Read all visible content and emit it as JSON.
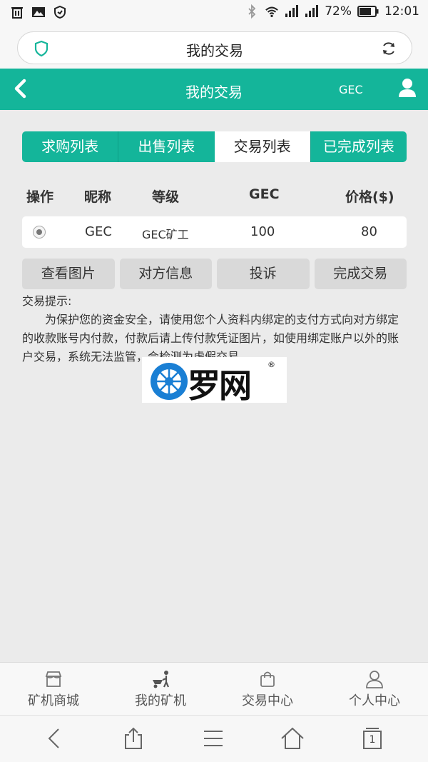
{
  "status_bar": {
    "battery": "72%",
    "time": "12:01"
  },
  "browser": {
    "url_title": "我的交易"
  },
  "header": {
    "title": "我的交易",
    "currency": "GEC"
  },
  "tabs": [
    {
      "label": "求购列表"
    },
    {
      "label": "出售列表"
    },
    {
      "label": "交易列表"
    },
    {
      "label": "已完成列表"
    }
  ],
  "table": {
    "columns": [
      "操作",
      "昵称",
      "等级",
      "GEC",
      "价格($)"
    ],
    "rows": [
      {
        "nickname": "GEC",
        "level": "GEC矿工",
        "gec": "100",
        "price": "80"
      }
    ]
  },
  "actions": [
    {
      "label": "查看图片"
    },
    {
      "label": "对方信息"
    },
    {
      "label": "投诉"
    },
    {
      "label": "完成交易"
    }
  ],
  "tips": {
    "title": "交易提示:",
    "body": "为保护您的资金安全，请使用您个人资料内绑定的支付方式向对方绑定的收款账号内付款，付款后请上传付款凭证图片，如使用绑定账户以外的账户交易，系统无法监管，会检测为虚假交易。"
  },
  "watermark": {
    "text": "罗网",
    "mark": "®"
  },
  "bottom_nav": [
    {
      "label": "矿机商城",
      "icon": "shop-icon"
    },
    {
      "label": "我的矿机",
      "icon": "miner-icon"
    },
    {
      "label": "交易中心",
      "icon": "bag-icon"
    },
    {
      "label": "个人中心",
      "icon": "person-icon"
    }
  ],
  "browser_toolbar": {
    "tab_count": "1"
  },
  "colors": {
    "accent": "#14b59a",
    "background": "#ebebeb"
  }
}
